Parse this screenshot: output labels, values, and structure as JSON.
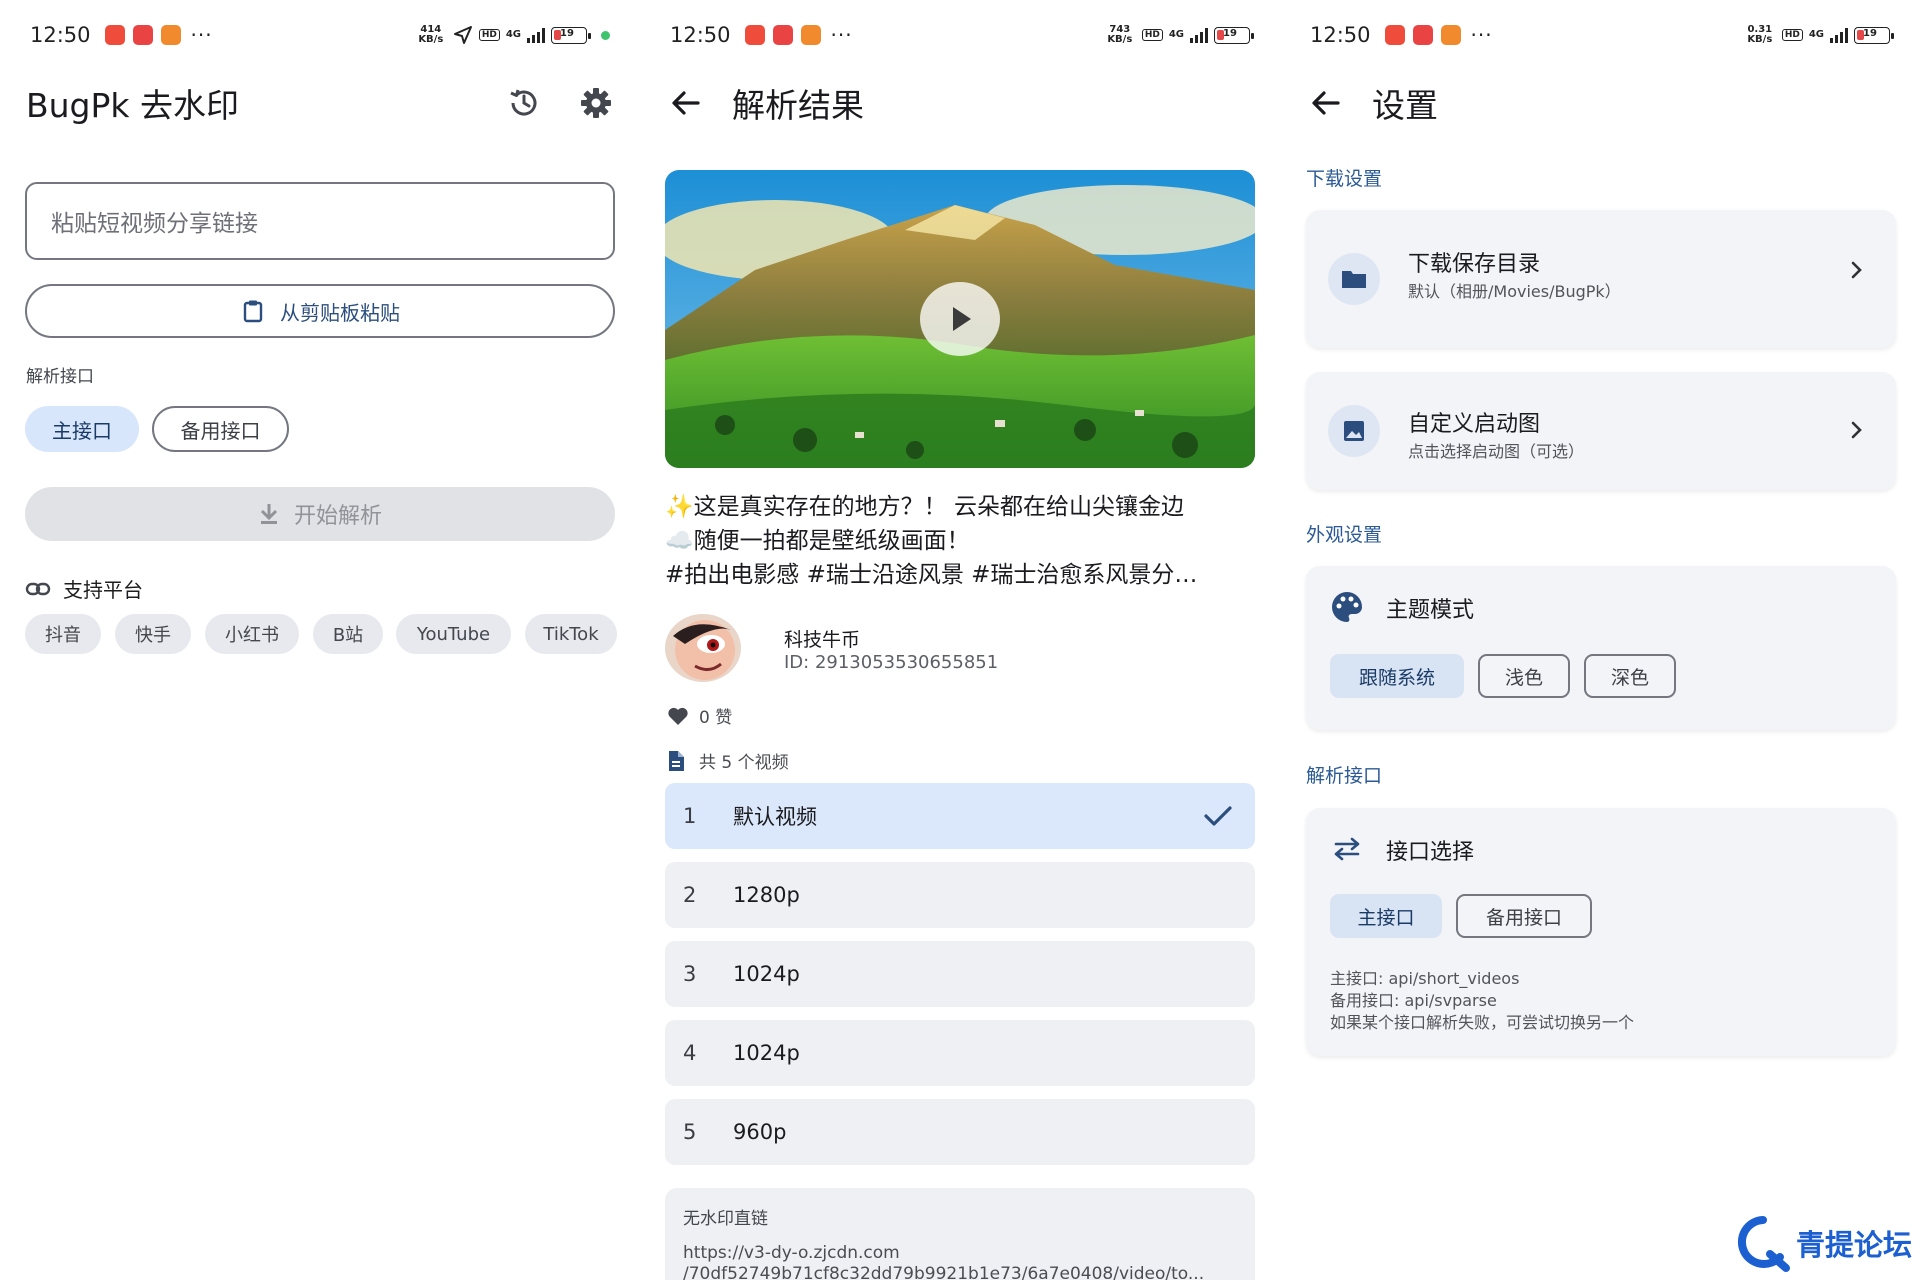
{
  "status_bars": [
    {
      "time": "12:50",
      "net": "414 KB/s",
      "network": "4G",
      "battery": "19"
    },
    {
      "time": "12:50",
      "net": "743 KB/s",
      "network": "4G",
      "battery": "19"
    },
    {
      "time": "12:50",
      "net": "0.31 KB/s",
      "network": "4G",
      "battery": "19"
    }
  ],
  "status_common": {
    "more": "···",
    "hd": "HD"
  },
  "home": {
    "title": "BugPk 去水印",
    "input_placeholder": "粘贴短视频分享链接",
    "paste_button": "从剪贴板粘贴",
    "api_label": "解析接口",
    "api_options": [
      "主接口",
      "备用接口"
    ],
    "api_selected_index": 0,
    "start_button": "开始解析",
    "platforms_label": "支持平台",
    "platforms": [
      "抖音",
      "快手",
      "小红书",
      "B站",
      "YouTube",
      "TikTok"
    ]
  },
  "result": {
    "title": "解析结果",
    "desc_line1": "✨这是真实存在的地方？！ 云朵都在给山尖镶金边",
    "desc_line2": "☁️随便一拍都是壁纸级画面！",
    "desc_line3": "#拍出电影感 #瑞士沿途风景 #瑞士治愈系风景分…",
    "author_name": "科技牛币",
    "author_id": "ID: 2913053530655851",
    "likes": "0 赞",
    "video_count": "共 5 个视频",
    "qualities": [
      {
        "num": "1",
        "label": "默认视频",
        "selected": true
      },
      {
        "num": "2",
        "label": "1280p",
        "selected": false
      },
      {
        "num": "3",
        "label": "1024p",
        "selected": false
      },
      {
        "num": "4",
        "label": "1024p",
        "selected": false
      },
      {
        "num": "5",
        "label": "960p",
        "selected": false
      }
    ],
    "link_title": "无水印直链",
    "link_line1": "https://v3-dy-o.zjcdn.com",
    "link_line2": "/70df52749b71cf8c32dd79b9921b1e73/6a7e0408/video/to..."
  },
  "settings": {
    "title": "设置",
    "download_header": "下载设置",
    "save_dir_title": "下载保存目录",
    "save_dir_sub": "默认（相册/Movies/BugPk）",
    "splash_title": "自定义启动图",
    "splash_sub": "点击选择启动图（可选）",
    "appearance_header": "外观设置",
    "theme_title": "主题模式",
    "theme_options": [
      "跟随系统",
      "浅色",
      "深色"
    ],
    "api_header": "解析接口",
    "api_title": "接口选择",
    "api_options": [
      "主接口",
      "备用接口"
    ],
    "api_note1": "主接口: api/short_videos",
    "api_note2": "备用接口: api/svparse",
    "api_note3": "如果某个接口解析失败，可尝试切换另一个"
  },
  "watermark": "青提论坛",
  "colors": {
    "accent": "#2b5a96",
    "selected_chip": "#d8e6fb",
    "watermark": "#1c5fd1"
  }
}
